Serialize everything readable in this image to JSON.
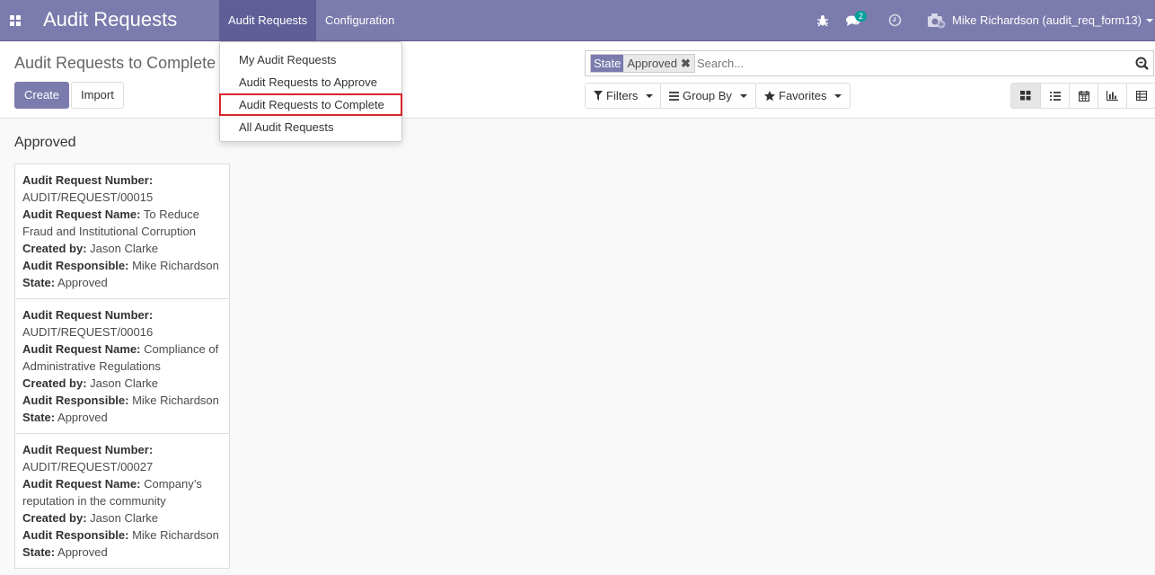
{
  "navbar": {
    "brand": "Audit Requests",
    "menus": [
      "Audit Requests",
      "Configuration"
    ],
    "messages_count": "2",
    "user": "Mike Richardson (audit_req_form13)"
  },
  "dropdown": {
    "items": [
      "My Audit Requests",
      "Audit Requests to Approve",
      "Audit Requests to Complete",
      "All Audit Requests"
    ]
  },
  "control_panel": {
    "breadcrumb": "Audit Requests to Complete",
    "create_label": "Create",
    "import_label": "Import",
    "facet_category": "State",
    "facet_value": "Approved",
    "search_placeholder": "Search...",
    "filters_label": "Filters",
    "groupby_label": "Group By",
    "favorites_label": "Favorites"
  },
  "kanban": {
    "group_title": "Approved",
    "field_labels": {
      "number": "Audit Request Number:",
      "name": "Audit Request Name:",
      "created_by": "Created by:",
      "responsible": "Audit Responsible:",
      "state": "State:"
    },
    "cards": [
      {
        "number": "AUDIT/REQUEST/00015",
        "name": "To Reduce Fraud and Institutional Corruption",
        "created_by": "Jason Clarke",
        "responsible": "Mike Richardson",
        "state": "Approved"
      },
      {
        "number": "AUDIT/REQUEST/00016",
        "name": "Compliance of Administrative Regulations",
        "created_by": "Jason Clarke",
        "responsible": "Mike Richardson",
        "state": "Approved"
      },
      {
        "number": "AUDIT/REQUEST/00027",
        "name": "Company’s reputation in the community",
        "created_by": "Jason Clarke",
        "responsible": "Mike Richardson",
        "state": "Approved"
      }
    ]
  },
  "colors": {
    "brand": "#7c7bad",
    "brand_dark": "#5f5e97",
    "badge": "#00a09d",
    "highlight": "#d9262a"
  }
}
